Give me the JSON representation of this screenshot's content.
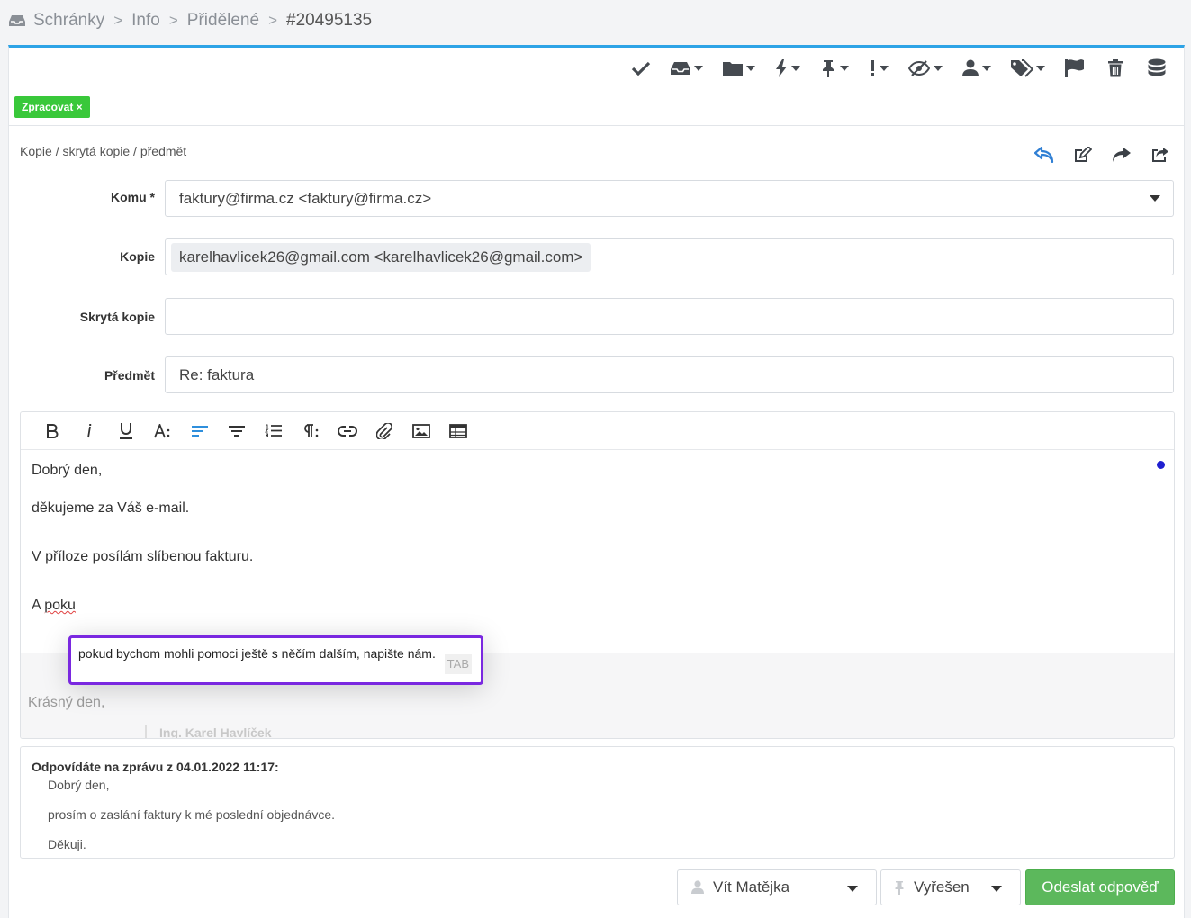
{
  "breadcrumb": {
    "items": [
      "Schránky",
      "Info",
      "Přidělené",
      "#20495135"
    ],
    "separator": ">"
  },
  "toolbar": {
    "icons": [
      "check-icon",
      "inbox-icon",
      "folder-icon",
      "lightning-icon",
      "pin-icon",
      "exclamation-icon",
      "eye-slash-icon",
      "user-icon",
      "tags-icon",
      "flag-icon",
      "trash-icon",
      "database-icon"
    ]
  },
  "tag": {
    "label": "Zpracovat ×",
    "color": "#39c83a"
  },
  "compose": {
    "cc_link": "Kopie / skrytá kopie / předmět",
    "reply_actions": [
      "reply-icon",
      "edit-icon",
      "forward-icon",
      "share-icon"
    ],
    "to_label": "Komu",
    "to_required": "*",
    "to_value": "faktury@firma.cz <faktury@firma.cz>",
    "cc_label": "Kopie",
    "cc_value": "karelhavlicek26@gmail.com <karelhavlicek26@gmail.com>",
    "bcc_label": "Skrytá kopie",
    "bcc_value": "",
    "subject_label": "Předmět",
    "subject_value": "Re: faktura"
  },
  "editor": {
    "toolbar_icons": [
      "bold-icon",
      "italic-icon",
      "underline-icon",
      "font-size-icon",
      "align-left-icon",
      "align-center-icon",
      "ordered-list-icon",
      "paragraph-icon",
      "link-icon",
      "attachment-icon",
      "image-icon",
      "table-icon"
    ],
    "lines": [
      "Dobrý den,",
      "děkujeme za Váš e-mail.",
      "V příloze posílám slíbenou fakturu."
    ],
    "current_prefix": "A ",
    "current_typed": "poku",
    "signature_greeting": "Krásný den,",
    "signature_name": "Ing. Karel Havlíček"
  },
  "suggestion": {
    "typed": "poku",
    "completion": "d bychom mohli pomoci ještě s něčím dalším, napište nám.",
    "hint": "TAB",
    "border_color": "#7a28e0"
  },
  "quote": {
    "header": "Odpovídáte na zprávu z 04.01.2022 11:17:",
    "lines": [
      "Dobrý den,",
      "prosím o zaslání faktury k mé poslední objednávce.",
      "Děkuji."
    ]
  },
  "footer": {
    "assignee": "Vít Matějka",
    "status": "Vyřešen",
    "send_label": "Odeslat odpověď",
    "send_color": "#5cb85c"
  }
}
